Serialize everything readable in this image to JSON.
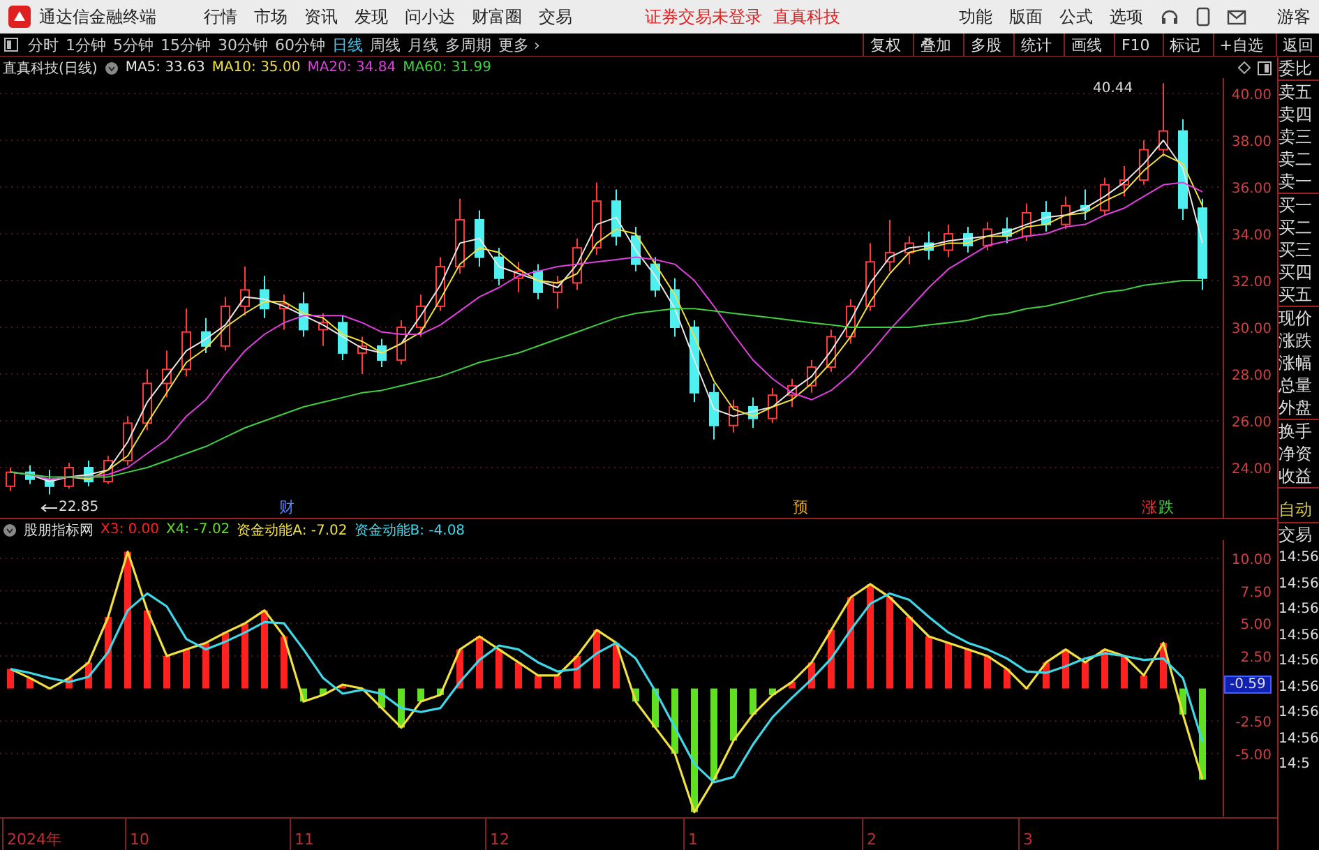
{
  "app": {
    "title": "通达信金融终端",
    "menu": [
      "行情",
      "市场",
      "资讯",
      "发现",
      "问小达",
      "财富圈",
      "交易"
    ],
    "login_status": "证券交易未登录",
    "stock_name": "直真科技",
    "right_menu": [
      "功能",
      "版面",
      "公式",
      "选项"
    ],
    "user": "游客"
  },
  "toolbar": {
    "periods": [
      {
        "label": "分时",
        "selected": false
      },
      {
        "label": "1分钟",
        "selected": false
      },
      {
        "label": "5分钟",
        "selected": false
      },
      {
        "label": "15分钟",
        "selected": false
      },
      {
        "label": "30分钟",
        "selected": false
      },
      {
        "label": "60分钟",
        "selected": false
      },
      {
        "label": "日线",
        "selected": true
      },
      {
        "label": "周线",
        "selected": false
      },
      {
        "label": "月线",
        "selected": false
      },
      {
        "label": "多周期",
        "selected": false
      }
    ],
    "more": "更多 ›",
    "actions": [
      "复权",
      "叠加",
      "多股",
      "统计",
      "画线",
      "F10",
      "标记",
      "+自选",
      "返回"
    ]
  },
  "main_chart": {
    "title": "直真科技(日线)",
    "legend_values": [
      ": 33.63",
      ": 35.00",
      ": 34.84",
      ": 31.99"
    ],
    "chart_data": {
      "type": "candlestick",
      "grid": true,
      "ylim": [
        21.85,
        40.66
      ],
      "yticks": [
        {
          "value": 40,
          "label": "40.00"
        },
        {
          "value": 38,
          "label": "38.00"
        },
        {
          "value": 36,
          "label": "36.00"
        },
        {
          "value": 34,
          "label": "34.00"
        },
        {
          "value": 32,
          "label": "32.00"
        },
        {
          "value": 30,
          "label": "30.00"
        },
        {
          "value": 28,
          "label": "28.00"
        },
        {
          "value": 26,
          "label": "26.00"
        },
        {
          "value": 24,
          "label": "24.00"
        }
      ],
      "ohlc": [
        [
          23.2,
          24.0,
          23.0,
          23.8
        ],
        [
          23.8,
          24.1,
          23.3,
          23.5
        ],
        [
          23.5,
          23.9,
          22.85,
          23.2
        ],
        [
          23.2,
          24.2,
          23.1,
          24.0
        ],
        [
          24.0,
          24.3,
          23.2,
          23.4
        ],
        [
          23.4,
          24.5,
          23.3,
          24.3
        ],
        [
          24.3,
          26.2,
          24.1,
          25.9
        ],
        [
          25.9,
          28.2,
          25.6,
          27.6
        ],
        [
          27.6,
          29.0,
          27.0,
          28.2
        ],
        [
          28.2,
          30.8,
          27.9,
          29.8
        ],
        [
          29.8,
          30.4,
          28.9,
          29.2
        ],
        [
          29.2,
          31.3,
          29.0,
          30.9
        ],
        [
          30.9,
          32.6,
          30.5,
          31.6
        ],
        [
          31.6,
          32.2,
          30.4,
          30.8
        ],
        [
          30.8,
          31.4,
          29.9,
          31.0
        ],
        [
          31.0,
          31.5,
          29.6,
          29.9
        ],
        [
          29.9,
          30.6,
          29.2,
          30.2
        ],
        [
          30.2,
          30.5,
          28.6,
          28.9
        ],
        [
          28.9,
          29.6,
          28.0,
          29.2
        ],
        [
          29.2,
          29.5,
          28.3,
          28.6
        ],
        [
          28.6,
          30.3,
          28.4,
          30.0
        ],
        [
          30.0,
          31.4,
          29.6,
          30.9
        ],
        [
          30.9,
          33.0,
          30.7,
          32.6
        ],
        [
          32.6,
          35.5,
          32.3,
          34.6
        ],
        [
          34.6,
          35.0,
          32.6,
          33.0
        ],
        [
          33.0,
          33.4,
          31.8,
          32.1
        ],
        [
          32.1,
          32.8,
          31.5,
          32.4
        ],
        [
          32.4,
          32.7,
          31.2,
          31.5
        ],
        [
          31.5,
          32.2,
          30.8,
          31.9
        ],
        [
          31.9,
          33.8,
          31.6,
          33.4
        ],
        [
          33.4,
          36.2,
          33.1,
          35.4
        ],
        [
          35.4,
          35.9,
          33.5,
          33.9
        ],
        [
          33.9,
          34.3,
          32.4,
          32.7
        ],
        [
          32.7,
          33.0,
          31.3,
          31.6
        ],
        [
          31.6,
          32.1,
          29.6,
          30.0
        ],
        [
          30.0,
          30.3,
          26.8,
          27.2
        ],
        [
          27.2,
          27.6,
          25.2,
          25.8
        ],
        [
          25.8,
          26.9,
          25.5,
          26.6
        ],
        [
          26.6,
          27.0,
          25.7,
          26.1
        ],
        [
          26.1,
          27.4,
          25.9,
          27.1
        ],
        [
          27.1,
          27.8,
          26.6,
          27.5
        ],
        [
          27.5,
          28.6,
          27.2,
          28.3
        ],
        [
          28.3,
          29.9,
          28.1,
          29.6
        ],
        [
          29.6,
          31.2,
          29.3,
          30.9
        ],
        [
          30.9,
          33.6,
          30.7,
          32.8
        ],
        [
          32.8,
          34.6,
          32.4,
          33.2
        ],
        [
          33.2,
          33.9,
          32.7,
          33.6
        ],
        [
          33.6,
          34.1,
          32.9,
          33.3
        ],
        [
          33.3,
          34.4,
          33.0,
          34.0
        ],
        [
          34.0,
          34.3,
          33.2,
          33.5
        ],
        [
          33.5,
          34.5,
          33.3,
          34.2
        ],
        [
          34.2,
          34.7,
          33.6,
          33.9
        ],
        [
          33.9,
          35.3,
          33.7,
          34.9
        ],
        [
          34.9,
          35.4,
          34.1,
          34.4
        ],
        [
          34.4,
          35.6,
          34.2,
          35.2
        ],
        [
          35.2,
          35.9,
          34.6,
          35.0
        ],
        [
          35.0,
          36.4,
          34.8,
          36.1
        ],
        [
          36.1,
          36.9,
          35.6,
          36.3
        ],
        [
          36.3,
          38.0,
          36.1,
          37.6
        ],
        [
          37.6,
          40.44,
          37.3,
          38.4
        ],
        [
          38.4,
          38.9,
          34.6,
          35.1
        ],
        [
          35.1,
          35.5,
          31.6,
          32.1
        ]
      ],
      "series": [
        {
          "name": "MA5",
          "type": "line",
          "color": "#e8e8e8",
          "values": [
            23.8,
            23.7,
            23.4,
            23.6,
            23.7,
            23.9,
            25.1,
            26.8,
            27.9,
            29.0,
            29.5,
            30.1,
            31.3,
            31.2,
            30.9,
            30.5,
            30.1,
            29.6,
            29.1,
            28.9,
            29.3,
            30.5,
            31.8,
            33.6,
            33.8,
            32.6,
            32.3,
            32.0,
            31.7,
            32.7,
            34.4,
            34.7,
            33.3,
            32.2,
            30.8,
            28.6,
            26.5,
            26.2,
            26.4,
            26.6,
            27.3,
            27.9,
            29.0,
            30.3,
            31.9,
            33.0,
            33.4,
            33.5,
            33.7,
            33.8,
            33.9,
            34.1,
            34.4,
            34.7,
            34.8,
            35.1,
            35.6,
            36.2,
            37.0,
            38.0,
            36.8,
            33.6
          ]
        },
        {
          "name": "MA10",
          "type": "line",
          "color": "#f0e040",
          "values": [
            null,
            null,
            null,
            23.6,
            23.5,
            23.9,
            24.5,
            25.9,
            27.2,
            28.5,
            29.1,
            30.0,
            30.6,
            31.1,
            31.1,
            30.6,
            30.4,
            29.7,
            29.4,
            28.9,
            29.3,
            29.8,
            31.2,
            32.7,
            33.4,
            33.2,
            32.5,
            32.0,
            31.9,
            32.3,
            33.6,
            34.2,
            34.0,
            32.7,
            31.4,
            29.6,
            27.7,
            26.5,
            26.2,
            26.6,
            26.9,
            27.6,
            28.5,
            29.6,
            31.1,
            32.3,
            33.2,
            33.4,
            33.6,
            33.6,
            33.9,
            33.9,
            34.3,
            34.4,
            34.8,
            34.9,
            35.4,
            35.8,
            36.7,
            37.4,
            37.0,
            35.2
          ]
        },
        {
          "name": "MA20",
          "type": "line",
          "color": "#e040e0",
          "values": [
            23.8,
            23.7,
            23.5,
            23.6,
            23.6,
            23.7,
            24.0,
            24.6,
            25.2,
            26.2,
            26.9,
            28.0,
            29.0,
            29.7,
            30.2,
            30.5,
            30.5,
            30.5,
            30.2,
            29.8,
            29.7,
            29.7,
            30.1,
            30.7,
            31.3,
            31.7,
            32.2,
            32.4,
            32.6,
            32.7,
            32.8,
            32.9,
            33.0,
            32.9,
            32.7,
            32.0,
            30.9,
            29.7,
            28.6,
            27.8,
            27.2,
            26.9,
            27.3,
            28.0,
            28.9,
            29.9,
            30.8,
            31.7,
            32.5,
            33.0,
            33.5,
            33.7,
            33.9,
            34.0,
            34.3,
            34.4,
            34.8,
            35.1,
            35.6,
            36.1,
            36.2,
            35.8
          ]
        },
        {
          "name": "MA60",
          "type": "line",
          "color": "#40d040",
          "values": [
            23.8,
            23.7,
            23.6,
            23.6,
            23.6,
            23.6,
            23.8,
            24.0,
            24.3,
            24.6,
            24.9,
            25.3,
            25.7,
            26.0,
            26.3,
            26.6,
            26.8,
            27.0,
            27.2,
            27.3,
            27.5,
            27.7,
            27.9,
            28.2,
            28.5,
            28.7,
            28.9,
            29.2,
            29.5,
            29.8,
            30.1,
            30.4,
            30.6,
            30.7,
            30.8,
            30.8,
            30.7,
            30.6,
            30.5,
            30.4,
            30.3,
            30.2,
            30.1,
            30.0,
            30.0,
            30.0,
            30.0,
            30.1,
            30.2,
            30.3,
            30.5,
            30.6,
            30.8,
            30.9,
            31.1,
            31.3,
            31.5,
            31.6,
            31.8,
            31.9,
            32.0,
            32.0
          ]
        }
      ]
    },
    "high_label": "40.44",
    "low_label": "22.85",
    "events": [
      {
        "text": "财",
        "kind": "info"
      },
      {
        "text": "预",
        "kind": "forecast"
      },
      {
        "text": "涨",
        "kind": "up"
      },
      {
        "text": "跌",
        "kind": "down"
      }
    ]
  },
  "sub_chart": {
    "title": "股朋指标网",
    "legend_values": [
      ": 0.00",
      ": -7.02",
      ": -7.02",
      ": -4.08"
    ],
    "chart_data": {
      "type": "bar",
      "grid": true,
      "ylim": [
        -9.83,
        11.39
      ],
      "yticks": [
        {
          "value": 10,
          "label": "10.00"
        },
        {
          "value": 7.5,
          "label": "7.50"
        },
        {
          "value": 5,
          "label": "5.00"
        },
        {
          "value": 2.5,
          "label": "2.50"
        },
        {
          "value": -2.5,
          "label": "-2.50"
        },
        {
          "value": -5,
          "label": "-5.00"
        }
      ],
      "series": [
        {
          "name": "X3",
          "type": "bar",
          "color": "#ff2020",
          "values": [
            1.5,
            0.8,
            0,
            0.8,
            2,
            5.5,
            10.5,
            6,
            2.5,
            3,
            3.5,
            4.3,
            5,
            6,
            4,
            null,
            null,
            0.3,
            0,
            null,
            null,
            null,
            null,
            3,
            4,
            3,
            2,
            1,
            1,
            2.5,
            4.5,
            3.5,
            null,
            null,
            null,
            null,
            null,
            null,
            null,
            null,
            0.5,
            2,
            4.5,
            7,
            8,
            7,
            5.5,
            4,
            3.5,
            3,
            2.5,
            1.5,
            0,
            2,
            3,
            2,
            3,
            2.5,
            1,
            3.5,
            null,
            null
          ]
        },
        {
          "name": "X4",
          "type": "bar",
          "color": "#60e020",
          "values": [
            null,
            null,
            null,
            null,
            null,
            null,
            null,
            null,
            null,
            null,
            null,
            null,
            null,
            null,
            null,
            -1,
            -0.5,
            null,
            null,
            -1.5,
            -3,
            -1,
            -0.5,
            null,
            null,
            null,
            null,
            null,
            null,
            null,
            null,
            null,
            -1,
            -3,
            -5,
            -9.5,
            -7,
            -4,
            -2,
            -0.5,
            null,
            null,
            null,
            null,
            null,
            null,
            null,
            null,
            null,
            null,
            null,
            null,
            null,
            null,
            null,
            null,
            null,
            null,
            null,
            null,
            -2,
            -7
          ]
        },
        {
          "name": "资金动能A",
          "type": "line",
          "color": "#f0e040",
          "values": [
            1.5,
            0.8,
            0,
            0.8,
            2,
            5.5,
            10.5,
            6,
            2.5,
            3,
            3.5,
            4.3,
            5,
            6,
            4,
            -1,
            -0.5,
            0.3,
            0,
            -1.5,
            -3,
            -1,
            -0.5,
            3,
            4,
            3,
            2,
            1,
            1,
            2.5,
            4.5,
            3.5,
            -1,
            -3,
            -5,
            -9.5,
            -7,
            -4,
            -2,
            -0.5,
            0.5,
            2,
            4.5,
            7,
            8,
            7,
            5.5,
            4,
            3.5,
            3,
            2.5,
            1.5,
            0,
            2,
            3,
            2,
            3,
            2.5,
            1,
            3.5,
            -2,
            -7
          ]
        },
        {
          "name": "资金动能B",
          "type": "line",
          "color": "#40d8e8",
          "values": [
            1.5,
            1.2,
            0.8,
            0.5,
            0.9,
            2.8,
            6.0,
            7.3,
            6.3,
            3.8,
            3.0,
            3.6,
            4.3,
            5.1,
            5.0,
            3.0,
            0.8,
            -0.4,
            -0.1,
            -0.4,
            -1.5,
            -1.8,
            -1.5,
            0.5,
            2.2,
            3.3,
            3.0,
            2.0,
            1.3,
            1.5,
            2.7,
            3.5,
            2.3,
            -0.2,
            -3.0,
            -5.8,
            -7.2,
            -6.8,
            -4.3,
            -2.2,
            -0.7,
            0.7,
            2.3,
            4.5,
            6.5,
            7.3,
            6.8,
            5.5,
            4.3,
            3.5,
            3.0,
            2.3,
            1.3,
            1.2,
            1.7,
            2.3,
            2.7,
            2.5,
            2.2,
            2.3,
            0.8,
            -4.1
          ]
        }
      ]
    },
    "current_value": "-0.59"
  },
  "date_axis": [
    "2024年",
    "10",
    "11",
    "12",
    "1",
    "2",
    "3"
  ],
  "side_panel": {
    "quote_groups": [
      [
        "委比"
      ],
      [
        "卖五",
        "卖四",
        "卖三",
        "卖二",
        "卖一"
      ],
      [
        "买一",
        "买二",
        "买三",
        "买四",
        "买五"
      ],
      [
        "现价",
        "涨跌",
        "涨幅",
        "总量",
        "外盘"
      ],
      [
        "换手",
        "净资",
        "收益"
      ]
    ],
    "mode": "自动",
    "trade_label": "交易",
    "times": [
      "14:56",
      "14:56",
      "14:56",
      "14:56",
      "14:56",
      "14:56",
      "14:56",
      "14:56",
      "14:5"
    ]
  }
}
